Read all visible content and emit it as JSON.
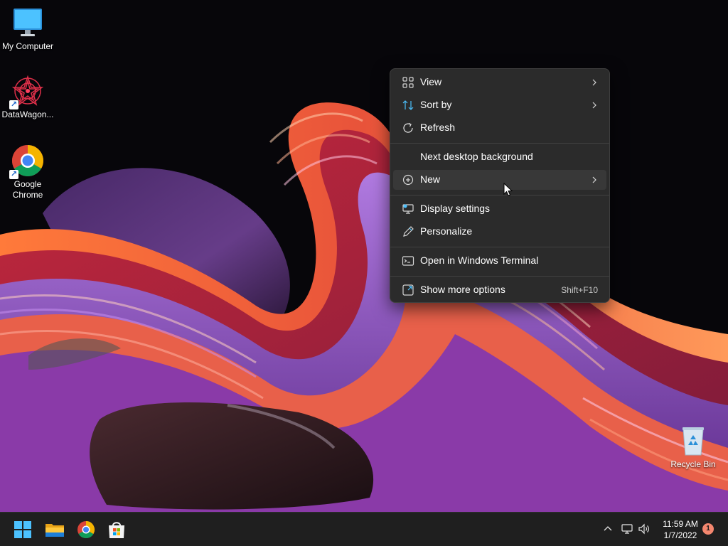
{
  "desktop": {
    "icons": [
      {
        "label": "My Computer",
        "icon": "monitor-icon"
      },
      {
        "label": "DataWagon...",
        "icon": "mandala-icon"
      },
      {
        "label": "Google Chrome",
        "icon": "chrome-icon"
      },
      {
        "label": "Recycle Bin",
        "icon": "recycle-bin-icon"
      }
    ]
  },
  "context_menu": {
    "items": [
      {
        "label": "View",
        "icon": "grid-icon",
        "submenu": true
      },
      {
        "label": "Sort by",
        "icon": "sort-icon",
        "submenu": true
      },
      {
        "label": "Refresh",
        "icon": "refresh-icon",
        "submenu": false
      },
      {
        "label": "Next desktop background",
        "icon": "",
        "submenu": false
      },
      {
        "label": "New",
        "icon": "plus-circle-icon",
        "submenu": true,
        "highlighted": true
      },
      {
        "label": "Display settings",
        "icon": "display-icon",
        "submenu": false
      },
      {
        "label": "Personalize",
        "icon": "pen-icon",
        "submenu": false
      },
      {
        "label": "Open in Windows Terminal",
        "icon": "terminal-icon",
        "submenu": false
      },
      {
        "label": "Show more options",
        "icon": "expand-icon",
        "shortcut": "Shift+F10"
      }
    ]
  },
  "taskbar": {
    "pinned": [
      "windows-start-icon",
      "file-explorer-icon",
      "chrome-icon",
      "store-icon"
    ],
    "tray": [
      "chevron-up-icon",
      "network-icon",
      "volume-icon"
    ],
    "time": "11:59 AM",
    "date": "1/7/2022",
    "notification_count": "1"
  },
  "colors": {
    "menu_bg": "#2b2b2b",
    "menu_hover": "#383838",
    "taskbar_bg": "#1f1f1f",
    "accent_blue": "#4cc2ff",
    "notification_badge": "#f4876f"
  }
}
